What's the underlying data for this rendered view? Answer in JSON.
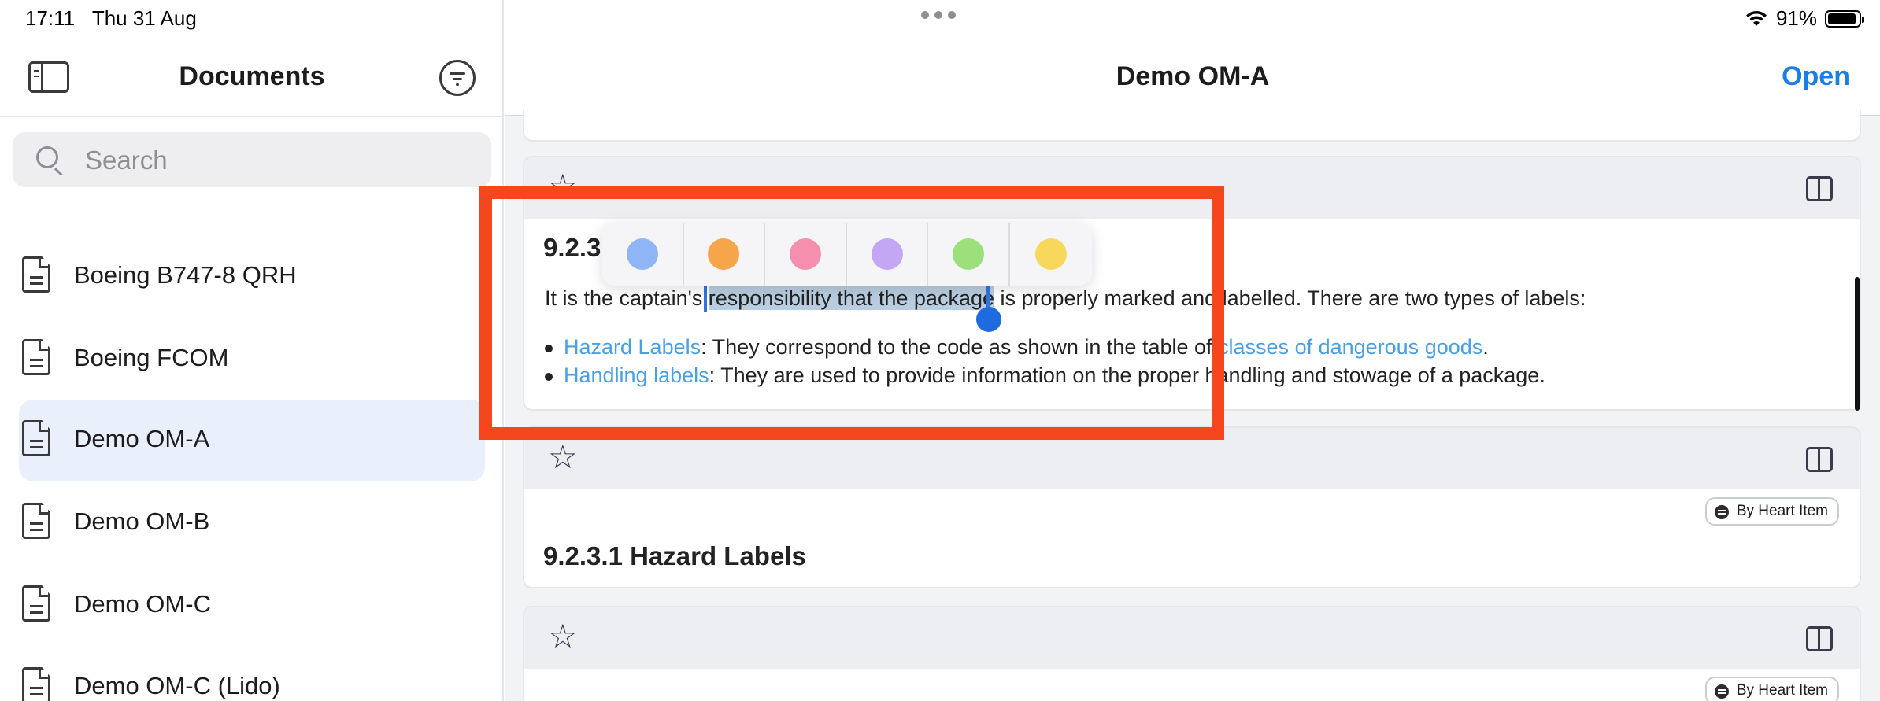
{
  "status_bar": {
    "time": "17:11",
    "date": "Thu 31 Aug",
    "battery": "91%",
    "battery_level": 0.91
  },
  "sidebar": {
    "title": "Documents",
    "search_placeholder": "Search",
    "items": [
      {
        "label": "Boeing B747-8 QRH",
        "active": false
      },
      {
        "label": "Boeing FCOM",
        "active": false
      },
      {
        "label": "Demo OM-A",
        "active": true
      },
      {
        "label": "Demo OM-B",
        "active": false
      },
      {
        "label": "Demo OM-C",
        "active": false
      },
      {
        "label": "Demo OM-C (Lido)",
        "active": false
      }
    ]
  },
  "main": {
    "title": "Demo OM-A",
    "open_label": "Open",
    "card1": {
      "heading": "9.2.3",
      "para_before": "It is the captain's ",
      "para_selected": "responsibility that the package",
      "para_after": " is properly marked and labelled. There are two types of labels:",
      "bullet1_link": "Hazard Labels",
      "bullet1_text": ": They correspond to the code as shown in the table of ",
      "bullet1_link2": "classes of dangerous goods",
      "bullet1_end": ".",
      "bullet2_link": "Handling labels",
      "bullet2_text": ": They are used to provide information on the proper handling and stowage of a package."
    },
    "card2": {
      "badge": "By Heart Item",
      "heading": "9.2.3.1 Hazard Labels"
    },
    "card3": {
      "badge": "By Heart Item"
    }
  },
  "highlight_colors": [
    "#8fb5f7",
    "#f7a54a",
    "#f58fad",
    "#c3a7f5",
    "#9ce07c",
    "#f8d85c"
  ],
  "accent_color": "#1a7ee6",
  "annotation_color": "#f5461e"
}
